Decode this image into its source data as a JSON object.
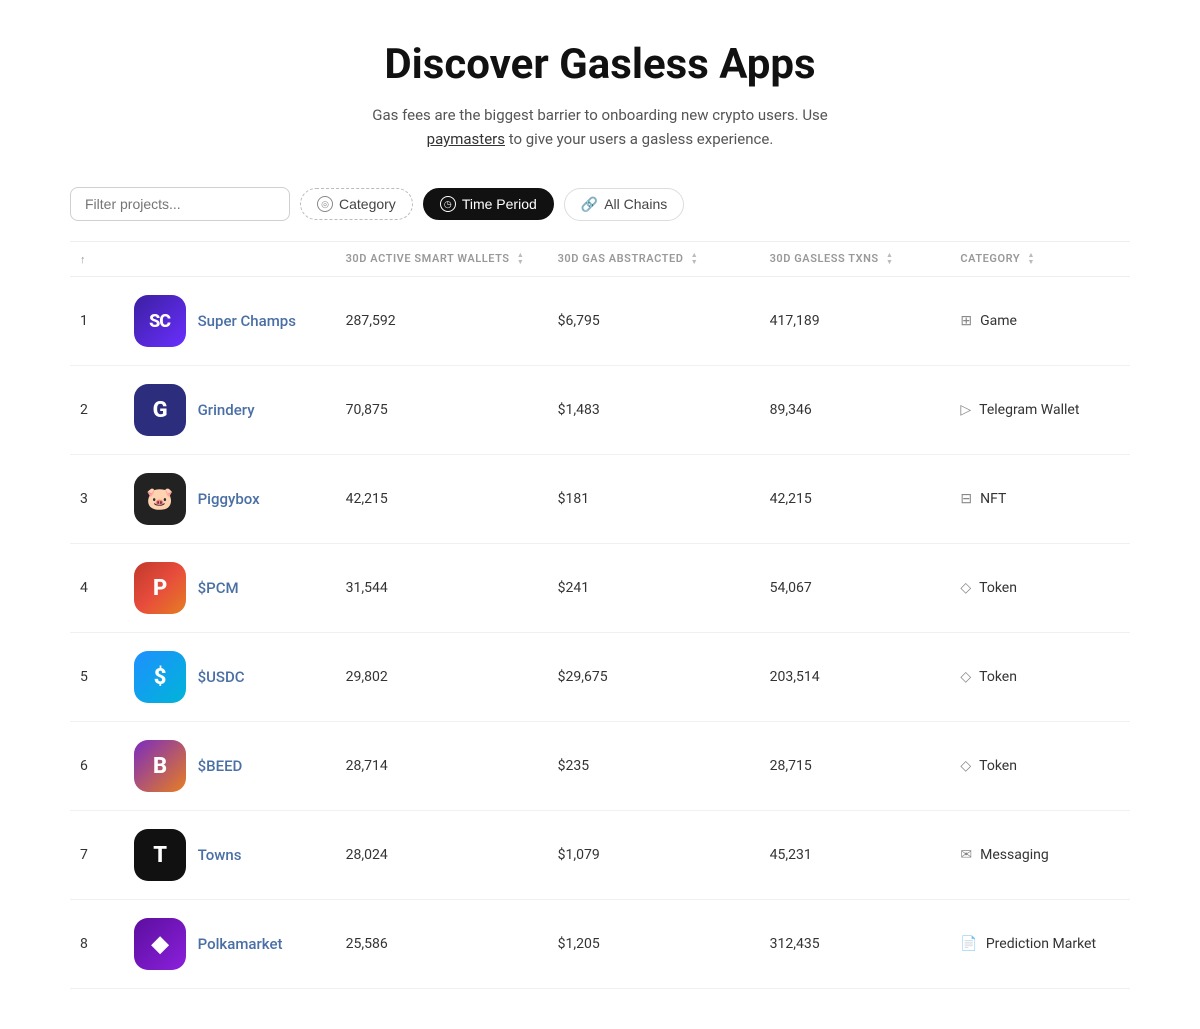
{
  "header": {
    "title": "Discover Gasless Apps",
    "subtitle": "Gas fees are the biggest barrier to onboarding new crypto users. Use",
    "subtitle_link": "paymasters",
    "subtitle_end": "to give your users a gasless experience."
  },
  "filters": {
    "search_placeholder": "Filter projects...",
    "category_label": "Category",
    "time_period_label": "Time Period",
    "all_chains_label": "All Chains"
  },
  "table": {
    "columns": {
      "rank": "↑",
      "name": "",
      "wallets": "30D Active Smart Wallets",
      "gas": "30D Gas Abstracted",
      "txns": "30D Gasless TXNs",
      "category": "Category"
    },
    "rows": [
      {
        "rank": "1",
        "name": "Super Champs",
        "logo_text": "SC",
        "logo_class": "logo-superchamps",
        "wallets": "287,592",
        "gas": "$6,795",
        "txns": "417,189",
        "category": "Game",
        "cat_icon": "⊞"
      },
      {
        "rank": "2",
        "name": "Grindery",
        "logo_text": "G",
        "logo_class": "logo-grindery",
        "wallets": "70,875",
        "gas": "$1,483",
        "txns": "89,346",
        "category": "Telegram Wallet",
        "cat_icon": "▷"
      },
      {
        "rank": "3",
        "name": "Piggybox",
        "logo_text": "🐷",
        "logo_class": "logo-piggybox",
        "wallets": "42,215",
        "gas": "$181",
        "txns": "42,215",
        "category": "NFT",
        "cat_icon": "⊟"
      },
      {
        "rank": "4",
        "name": "$PCM",
        "logo_text": "P",
        "logo_class": "logo-spcm",
        "wallets": "31,544",
        "gas": "$241",
        "txns": "54,067",
        "category": "Token",
        "cat_icon": "◇"
      },
      {
        "rank": "5",
        "name": "$USDC",
        "logo_text": "$",
        "logo_class": "logo-susdc",
        "wallets": "29,802",
        "gas": "$29,675",
        "txns": "203,514",
        "category": "Token",
        "cat_icon": "◇"
      },
      {
        "rank": "6",
        "name": "$BEED",
        "logo_text": "B",
        "logo_class": "logo-sbeed",
        "wallets": "28,714",
        "gas": "$235",
        "txns": "28,715",
        "category": "Token",
        "cat_icon": "◇"
      },
      {
        "rank": "7",
        "name": "Towns",
        "logo_text": "T",
        "logo_class": "logo-towns",
        "wallets": "28,024",
        "gas": "$1,079",
        "txns": "45,231",
        "category": "Messaging",
        "cat_icon": "✉"
      },
      {
        "rank": "8",
        "name": "Polkamarket",
        "logo_text": "◆",
        "logo_class": "logo-polkamarket",
        "wallets": "25,586",
        "gas": "$1,205",
        "txns": "312,435",
        "category": "Prediction Market",
        "cat_icon": "📄"
      }
    ]
  }
}
